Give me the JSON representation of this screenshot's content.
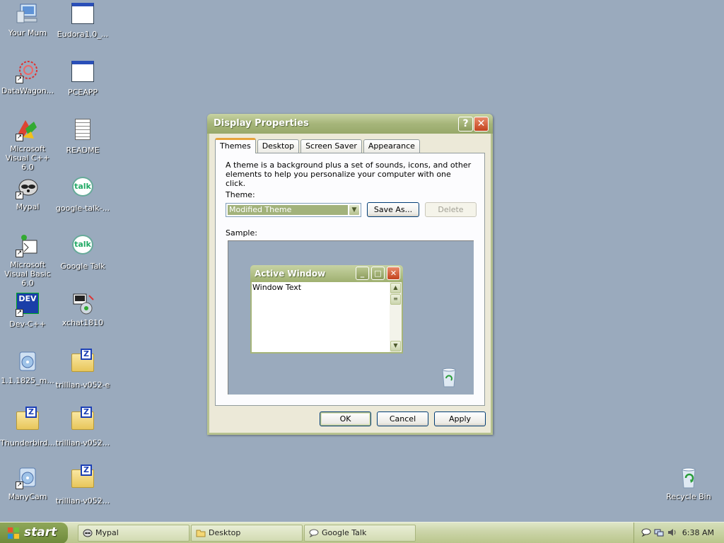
{
  "desktop": {
    "icons": [
      {
        "label": "Your Mum"
      },
      {
        "label": "Eudora1.0_..."
      },
      {
        "label": "DataWagon..."
      },
      {
        "label": "PCEAPP"
      },
      {
        "label": "Microsoft Visual C++ 6.0"
      },
      {
        "label": "README"
      },
      {
        "label": "Mypal"
      },
      {
        "label": "google-talk-..."
      },
      {
        "label": "Microsoft Visual Basic 6.0"
      },
      {
        "label": "Google Talk"
      },
      {
        "label": "Dev-C++"
      },
      {
        "label": "xchat1810"
      },
      {
        "label": "1.1.1825_m..."
      },
      {
        "label": "trillian-v052-e"
      },
      {
        "label": "Thunderbird..."
      },
      {
        "label": "trillian-v052..."
      },
      {
        "label": "ManyCam"
      },
      {
        "label": "trillian-v052..."
      },
      {
        "label": "Recycle Bin"
      }
    ],
    "talk_icon_text": "talk",
    "dev_icon_text": "DEV",
    "z_glyph": "Z",
    "arrow_glyph": "↗"
  },
  "dialog": {
    "title": "Display Properties",
    "help_glyph": "?",
    "close_glyph": "✕",
    "tabs": [
      "Themes",
      "Desktop",
      "Screen Saver",
      "Appearance"
    ],
    "description": "A theme is a background plus a set of sounds, icons, and other elements to help you personalize your computer with one click.",
    "theme_label": "Theme:",
    "theme_value": "Modified Theme",
    "save_as_label": "Save As...",
    "delete_label": "Delete",
    "sample_label": "Sample:",
    "sample_window": {
      "title": "Active Window",
      "body_text": "Window Text",
      "min_glyph": "_",
      "max_glyph": "□",
      "close_glyph": "✕"
    },
    "ok_label": "OK",
    "cancel_label": "Cancel",
    "apply_label": "Apply"
  },
  "taskbar": {
    "start_label": "start",
    "tasks": [
      "Mypal",
      "Desktop",
      "Google Talk"
    ],
    "clock": "6:38 AM"
  },
  "colors": {
    "desktop_bg": "#9aaabd",
    "titlebar": "#a6b57a",
    "accent_tab": "#e6a33a"
  }
}
